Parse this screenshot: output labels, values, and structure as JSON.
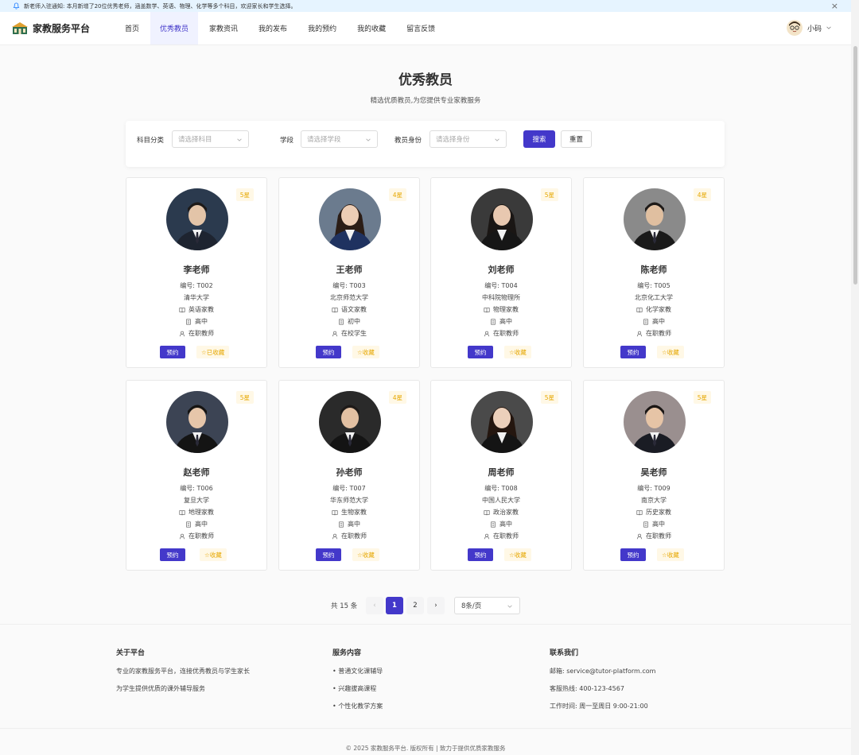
{
  "notice": {
    "text": "新老师入驻通知: 本月新增了20位优秀老师，涵盖数学、英语、物理、化学等多个科目，欢迎家长和学生选择。",
    "close": "×"
  },
  "brand": {
    "name": "家教服务平台"
  },
  "nav": [
    {
      "label": "首页"
    },
    {
      "label": "优秀教员"
    },
    {
      "label": "家教资讯"
    },
    {
      "label": "我的发布"
    },
    {
      "label": "我的预约"
    },
    {
      "label": "我的收藏"
    },
    {
      "label": "留言反馈"
    }
  ],
  "user": {
    "name": "小码"
  },
  "page": {
    "title": "优秀教员",
    "subtitle": "精选优质教员,为您提供专业家教服务"
  },
  "filter": {
    "subject_label": "科目分类",
    "subject_placeholder": "请选择科目",
    "stage_label": "学段",
    "stage_placeholder": "请选择学段",
    "identity_label": "教员身份",
    "identity_placeholder": "请选择身份",
    "search": "搜索",
    "reset": "重置"
  },
  "teachers": [
    {
      "name": "李老师",
      "code": "编号: T002",
      "school": "清华大学",
      "subject": "英语家教",
      "stage": "高中",
      "identity": "在职教师",
      "stars": "5星",
      "book": "预约",
      "fav": "☆已收藏"
    },
    {
      "name": "王老师",
      "code": "编号: T003",
      "school": "北京师范大学",
      "subject": "语文家教",
      "stage": "初中",
      "identity": "在校学生",
      "stars": "4星",
      "book": "预约",
      "fav": "☆收藏"
    },
    {
      "name": "刘老师",
      "code": "编号: T004",
      "school": "中科院物理所",
      "subject": "物理家教",
      "stage": "高中",
      "identity": "在职教师",
      "stars": "5星",
      "book": "预约",
      "fav": "☆收藏"
    },
    {
      "name": "陈老师",
      "code": "编号: T005",
      "school": "北京化工大学",
      "subject": "化学家教",
      "stage": "高中",
      "identity": "在职教师",
      "stars": "4星",
      "book": "预约",
      "fav": "☆收藏"
    },
    {
      "name": "赵老师",
      "code": "编号: T006",
      "school": "复旦大学",
      "subject": "地理家教",
      "stage": "高中",
      "identity": "在职教师",
      "stars": "5星",
      "book": "预约",
      "fav": "☆收藏"
    },
    {
      "name": "孙老师",
      "code": "编号: T007",
      "school": "华东师范大学",
      "subject": "生物家教",
      "stage": "高中",
      "identity": "在职教师",
      "stars": "4星",
      "book": "预约",
      "fav": "☆收藏"
    },
    {
      "name": "周老师",
      "code": "编号: T008",
      "school": "中国人民大学",
      "subject": "政治家教",
      "stage": "高中",
      "identity": "在职教师",
      "stars": "5星",
      "book": "预约",
      "fav": "☆收藏"
    },
    {
      "name": "吴老师",
      "code": "编号: T009",
      "school": "南京大学",
      "subject": "历史家教",
      "stage": "高中",
      "identity": "在职教师",
      "stars": "5星",
      "book": "预约",
      "fav": "☆收藏"
    }
  ],
  "pagination": {
    "total": "共 15 条",
    "prev": "‹",
    "pages": [
      "1",
      "2"
    ],
    "next": "›",
    "size": "8条/页"
  },
  "footer": {
    "about_title": "关于平台",
    "about_lines": [
      "专业的家教服务平台，连接优秀教员与学生家长",
      "为学生提供优质的课外辅导服务"
    ],
    "service_title": "服务内容",
    "service_lines": [
      "• 普通文化课辅导",
      "• 兴趣拔高课程",
      "• 个性化教学方案"
    ],
    "contact_title": "联系我们",
    "contact_lines": [
      "邮箱: service@tutor-platform.com",
      "客服热线: 400-123-4567",
      "工作时间: 周一至周日 9:00-21:00"
    ],
    "copyright": "© 2025 家教服务平台. 版权所有 | 致力于提供优质家教服务"
  },
  "colors": {
    "primary": "#4338ca",
    "star_bg": "#fff8e6",
    "star_text": "#e6a700",
    "notice_bg": "#e6f4ff"
  }
}
